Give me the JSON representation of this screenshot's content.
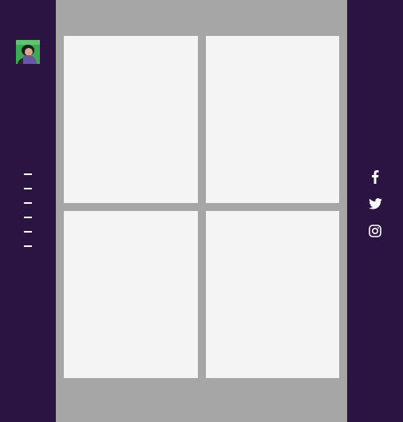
{
  "colors": {
    "sidebar_background": "#2b1441",
    "main_background": "#a6a6a6",
    "card_background": "#f4f4f4",
    "icon_color": "#ffffff",
    "avatar_background": "#3cab55"
  },
  "profile": {
    "avatar_icon": "user-avatar"
  },
  "nav": {
    "items": [
      {
        "icon": "dash"
      },
      {
        "icon": "dash"
      },
      {
        "icon": "dash"
      },
      {
        "icon": "dash"
      },
      {
        "icon": "dash"
      },
      {
        "icon": "dash"
      }
    ]
  },
  "social": {
    "items": [
      {
        "icon": "facebook-icon"
      },
      {
        "icon": "twitter-icon"
      },
      {
        "icon": "instagram-icon"
      }
    ]
  },
  "gallery": {
    "cards": [
      {
        "content": ""
      },
      {
        "content": ""
      },
      {
        "content": ""
      },
      {
        "content": ""
      }
    ]
  }
}
